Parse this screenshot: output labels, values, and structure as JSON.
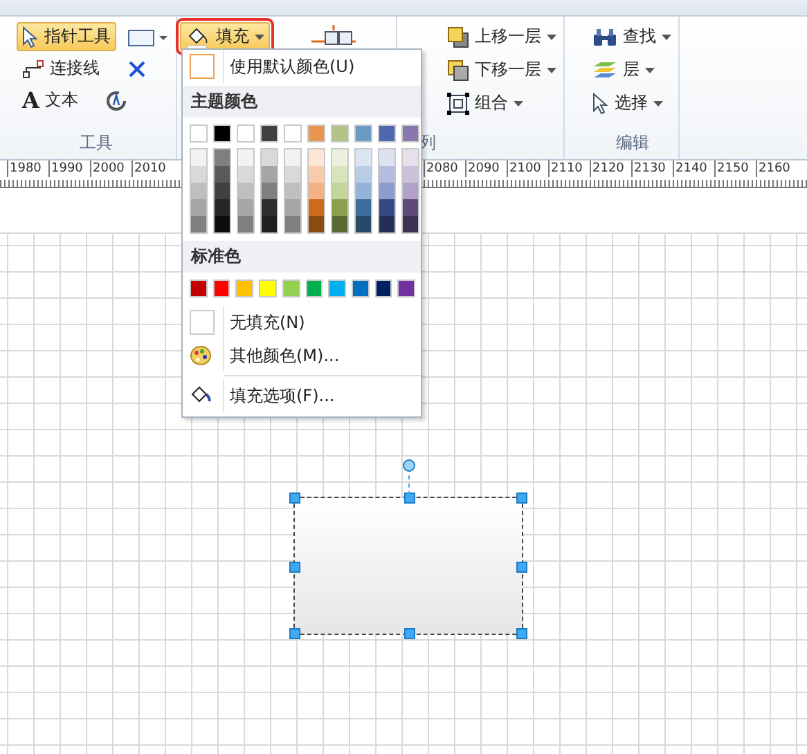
{
  "ribbon": {
    "tools_group": {
      "label": "工具",
      "pointer_tool": {
        "label": "指针工具",
        "selected": true
      },
      "connector": "连接线",
      "text_icon": "A",
      "text": "文本"
    },
    "fill_button": {
      "label": "填充",
      "selected": true
    },
    "arrange_group": {
      "label": "列",
      "bring_forward": "上移一层",
      "send_backward": "下移一层",
      "group": "组合"
    },
    "editing_group": {
      "label": "编辑",
      "find": "查找",
      "layers": "层",
      "select": "选择"
    }
  },
  "ruler": {
    "left_ticks": [
      "1980",
      "1990",
      "2000",
      "2010"
    ],
    "right_ticks": [
      "2080",
      "2090",
      "2100",
      "2110",
      "2120",
      "2130",
      "2140",
      "2150",
      "2160"
    ]
  },
  "fill_menu": {
    "default_color": "使用默认颜色(U)",
    "theme_header": "主题颜色",
    "theme_colors": [
      {
        "color": "#ffffff",
        "shades": [
          {
            "color": "#f2f2f2"
          },
          {
            "color": "#d9d9d9"
          },
          {
            "color": "#bfbfbf"
          },
          {
            "color": "#a6a6a6"
          },
          {
            "color": "#808080"
          }
        ]
      },
      {
        "color": "#000000",
        "shades": [
          {
            "color": "#7f7f7f"
          },
          {
            "color": "#595959"
          },
          {
            "color": "#404040"
          },
          {
            "color": "#262626"
          },
          {
            "color": "#0d0d0d"
          }
        ]
      },
      {
        "color": "#ffffff",
        "shades": [
          {
            "color": "#f2f2f2"
          },
          {
            "color": "#d9d9d9"
          },
          {
            "color": "#bfbfbf"
          },
          {
            "color": "#a6a6a6"
          },
          {
            "color": "#808080"
          }
        ]
      },
      {
        "color": "#404040",
        "shades": [
          {
            "color": "#d9d9d9"
          },
          {
            "color": "#a6a6a6"
          },
          {
            "color": "#808080"
          },
          {
            "color": "#2e2e2e"
          },
          {
            "color": "#1f1f1f"
          }
        ]
      },
      {
        "color": "#ffffff",
        "shades": [
          {
            "color": "#f2f2f2"
          },
          {
            "color": "#d9d9d9"
          },
          {
            "color": "#bfbfbf"
          },
          {
            "color": "#a6a6a6"
          },
          {
            "color": "#808080"
          }
        ]
      },
      {
        "color": "#e8954f",
        "shades": [
          {
            "color": "#fbe5d6"
          },
          {
            "color": "#f8cbad"
          },
          {
            "color": "#f4b183"
          },
          {
            "color": "#d0691b"
          },
          {
            "color": "#8a4a12"
          }
        ]
      },
      {
        "color": "#b3c388",
        "shades": [
          {
            "color": "#ebf1de"
          },
          {
            "color": "#d7e4bc"
          },
          {
            "color": "#c3d69b"
          },
          {
            "color": "#8aa04e"
          },
          {
            "color": "#5a6b32"
          }
        ]
      },
      {
        "color": "#6b9ac4",
        "shades": [
          {
            "color": "#dce6f2"
          },
          {
            "color": "#b9cde5"
          },
          {
            "color": "#95b3d7"
          },
          {
            "color": "#3c6e9c"
          },
          {
            "color": "#284a6a"
          }
        ]
      },
      {
        "color": "#4f67b0",
        "shades": [
          {
            "color": "#dde1f0"
          },
          {
            "color": "#b4bde0"
          },
          {
            "color": "#8e9bce"
          },
          {
            "color": "#354a84"
          },
          {
            "color": "#232f58"
          }
        ]
      },
      {
        "color": "#8a77ad",
        "shades": [
          {
            "color": "#e5e0ec"
          },
          {
            "color": "#ccc1da"
          },
          {
            "color": "#b3a2c7"
          },
          {
            "color": "#5f497a"
          },
          {
            "color": "#3f3151"
          }
        ]
      }
    ],
    "standard_header": "标准色",
    "standard_colors": [
      {
        "color": "#c00000"
      },
      {
        "color": "#ff0000"
      },
      {
        "color": "#ffc000"
      },
      {
        "color": "#ffff00"
      },
      {
        "color": "#92d050"
      },
      {
        "color": "#00b050"
      },
      {
        "color": "#00b0f0"
      },
      {
        "color": "#0070c0"
      },
      {
        "color": "#002060"
      },
      {
        "color": "#7030a0"
      }
    ],
    "no_fill": "无填充(N)",
    "more_colors": "其他颜色(M)...",
    "fill_options": "填充选项(F)..."
  }
}
